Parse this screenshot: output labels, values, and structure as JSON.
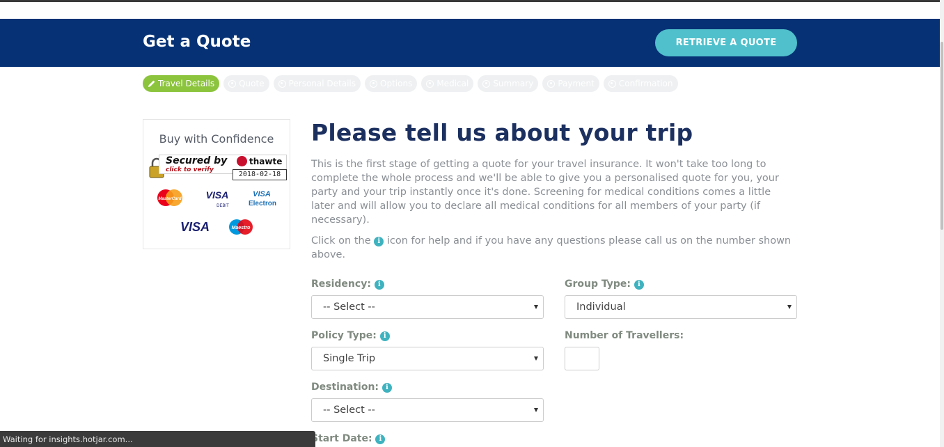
{
  "header": {
    "title": "Get a Quote",
    "retrieve_label": "RETRIEVE A QUOTE"
  },
  "steps": [
    {
      "label": "Travel Details",
      "active": true
    },
    {
      "label": "Quote",
      "active": false
    },
    {
      "label": "Personal Details",
      "active": false
    },
    {
      "label": "Options",
      "active": false
    },
    {
      "label": "Medical",
      "active": false
    },
    {
      "label": "Summary",
      "active": false
    },
    {
      "label": "Payment",
      "active": false
    },
    {
      "label": "Confirmation",
      "active": false
    }
  ],
  "confidence": {
    "title": "Buy with Confidence",
    "thawte_secured": "Secured by",
    "thawte_click": "click to verify",
    "thawte_brand": "thawte",
    "thawte_date": "2018-02-18",
    "cards": [
      "MasterCard",
      "VISA DEBIT",
      "VISA Electron",
      "VISA",
      "Maestro"
    ]
  },
  "main": {
    "title": "Please tell us about your trip",
    "intro": "This is the first stage of getting a quote for your travel insurance. It won't take too long to complete the whole process and we'll be able to give you a personalised quote for you, your party and your trip instantly once it's done. Screening for medical conditions comes a little later and will allow you to declare all medical conditions for all members of your party (if necessary).",
    "help_before": "Click on the",
    "help_after": "icon for help and if you have any questions please call us on the number shown above."
  },
  "form": {
    "residency_label": "Residency:",
    "residency_value": "-- Select --",
    "group_type_label": "Group Type:",
    "group_type_value": "Individual",
    "policy_type_label": "Policy Type:",
    "policy_type_value": "Single Trip",
    "travellers_label": "Number of Travellers:",
    "travellers_value": "",
    "destination_label": "Destination:",
    "destination_value": "-- Select --",
    "start_date_label": "Start Date:"
  },
  "status": {
    "text": "Waiting for insights.hotjar.com..."
  },
  "colors": {
    "header": "#063275",
    "retrieve_button": "#4fc0cc",
    "active_step": "#8cc43d",
    "title": "#1c3060",
    "info_icon": "#3fb2bf"
  }
}
